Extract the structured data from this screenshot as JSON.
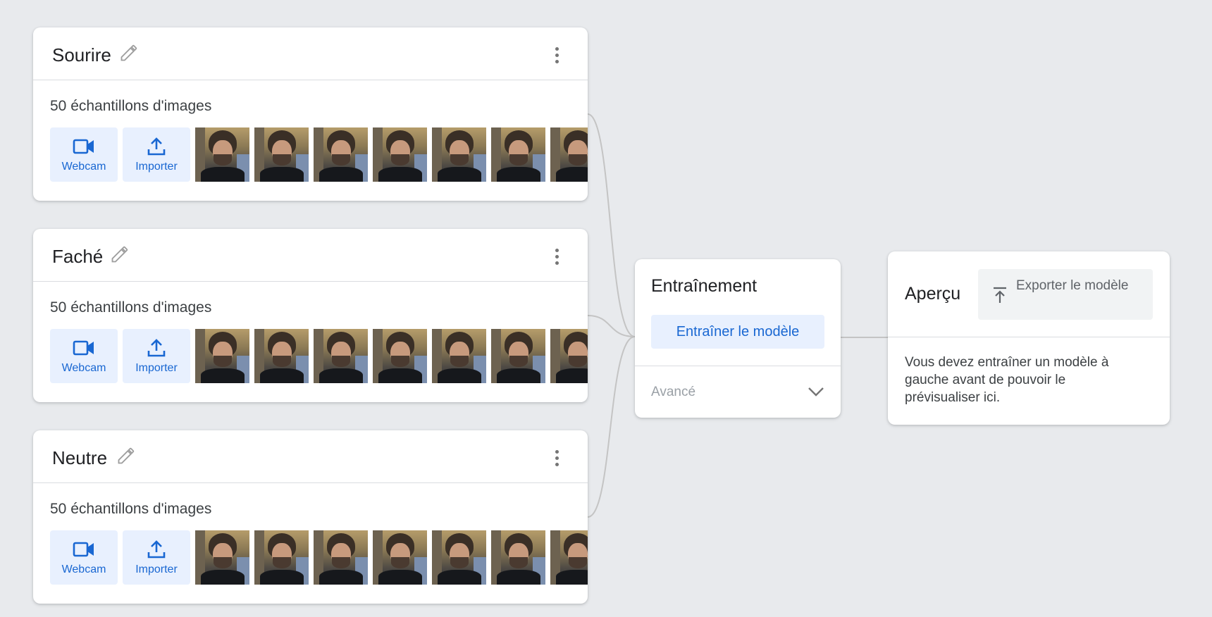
{
  "classes": [
    {
      "name": "Sourire",
      "sample_count": "50 échantillons d'images",
      "webcam_label": "Webcam",
      "upload_label": "Importer",
      "visible_thumbnails": 7
    },
    {
      "name": "Faché",
      "sample_count": "50 échantillons d'images",
      "webcam_label": "Webcam",
      "upload_label": "Importer",
      "visible_thumbnails": 7
    },
    {
      "name": "Neutre",
      "sample_count": "50 échantillons d'images",
      "webcam_label": "Webcam",
      "upload_label": "Importer",
      "visible_thumbnails": 7
    }
  ],
  "training": {
    "title": "Entraînement",
    "train_button": "Entraîner le modèle",
    "advanced_label": "Avancé"
  },
  "preview": {
    "title": "Aperçu",
    "export_button": "Exporter le modèle",
    "message": "Vous devez entraîner un modèle à gauche avant de pouvoir le prévisualiser ici."
  },
  "colors": {
    "background": "#e8eaed",
    "accent": "#1967d2",
    "accent_bg": "#e8f0fe",
    "connector": "#bdbdbd"
  },
  "icons": {
    "edit": "pencil-icon",
    "menu": "more-vert-icon",
    "webcam": "videocam-icon",
    "upload": "upload-icon",
    "expand": "chevron-down-icon",
    "export": "export-icon"
  }
}
